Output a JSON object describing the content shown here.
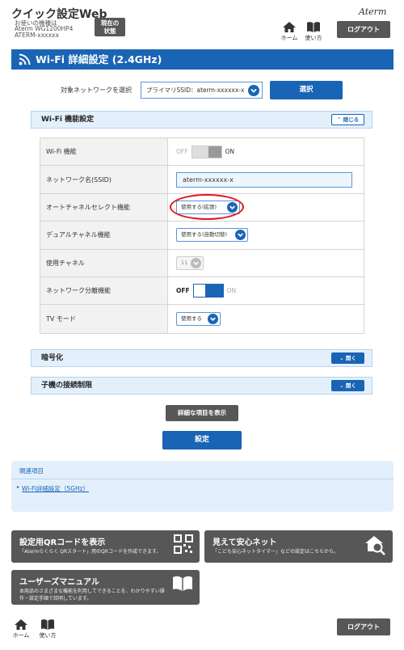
{
  "header": {
    "app_title": "クイック設定Web",
    "device_label": "お使いの機種は",
    "model": "Aterm WG1200HP4",
    "ssid": "ATERM-xxxxxx",
    "status_line1": "現在の",
    "status_line2": "状態",
    "brand": "Aterm",
    "home_label": "ホーム",
    "help_label": "使い方",
    "logout_label": "ログアウト"
  },
  "page": {
    "title": "Wi-Fi 詳細設定 (2.4GHz)",
    "network_label": "対象ネットワークを選択",
    "network_value": "プライマリSSID：aterm-xxxxxx-x",
    "select_button": "選択"
  },
  "wifi_section": {
    "title": "Wi-Fi 機能設定",
    "toggle_label": "閉じる",
    "rows": {
      "wifi": {
        "label": "Wi-Fi 機能",
        "off": "OFF",
        "on": "ON"
      },
      "ssid": {
        "label": "ネットワーク名(SSID)",
        "value": "aterm-xxxxxx-x"
      },
      "auto_channel": {
        "label": "オートチャネルセレクト機能",
        "value": "使用する(拡張)"
      },
      "dual_channel": {
        "label": "デュアルチャネル機能",
        "value": "使用する(自動切替)"
      },
      "channel": {
        "label": "使用チャネル",
        "value": "11"
      },
      "separation": {
        "label": "ネットワーク分離機能",
        "off": "OFF",
        "on": "ON"
      },
      "tv_mode": {
        "label": "TV モード",
        "value": "使用する"
      }
    }
  },
  "encryption_section": {
    "title": "暗号化",
    "toggle_label": "開く"
  },
  "mac_section": {
    "title": "子機の接続制限",
    "toggle_label": "開く"
  },
  "actions": {
    "detail_button": "詳細な項目を表示",
    "set_button": "設定"
  },
  "related": {
    "heading": "関連項目",
    "link": "Wi-Fi詳細設定（5GHz）"
  },
  "cards": {
    "qr": {
      "title": "設定用QRコードを表示",
      "desc": "「Atermらくらく QRスタート」用のQRコードを作成できます。"
    },
    "mimamori": {
      "title": "見えて安心ネット",
      "desc": "「こども安心ネットタイマー」などの設定はこちらから。"
    },
    "manual": {
      "title": "ユーザーズマニュアル",
      "desc1": "本商品のさまざまな機能を利用してできることを、わかりやすい操",
      "desc2": "作・設定手順で説明しています。"
    }
  },
  "footer": {
    "home_label": "ホーム",
    "help_label": "使い方",
    "logout_label": "ログアウト"
  },
  "colors": {
    "brand_blue": "#1a64b5",
    "panel_blue": "#e3f0fb",
    "dark_gray": "#575757",
    "highlight_red": "#e3161e"
  }
}
